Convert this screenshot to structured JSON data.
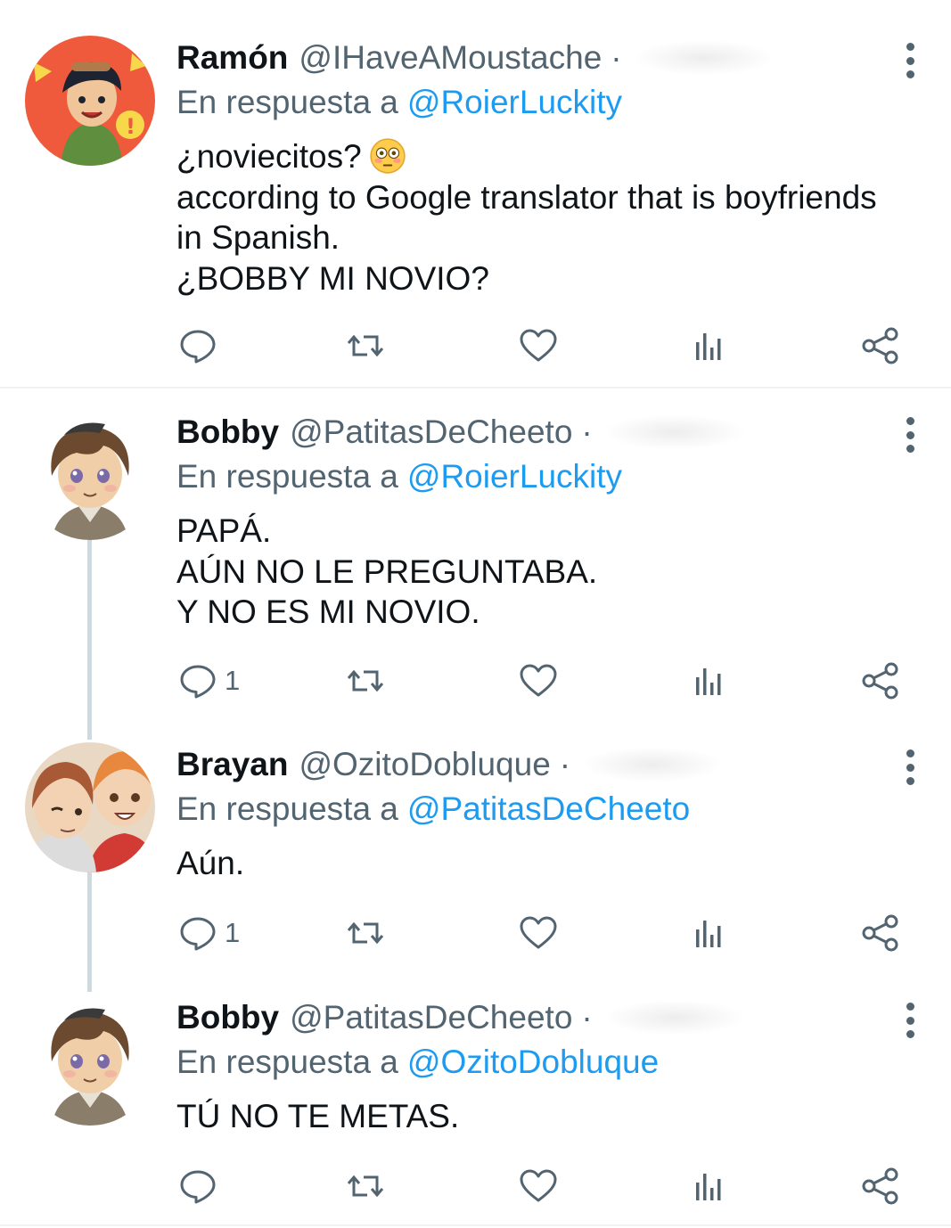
{
  "tweets": [
    {
      "name": "Ramón",
      "handle": "@IHaveAMoustache",
      "separator": "·",
      "reply_prefix": "En respuesta a",
      "reply_to": "@RoierLuckity",
      "lines": [
        "¿noviecitos?",
        "according to Google translator that is boyfriends",
        "in Spanish.",
        "¿BOBBY MI NOVIO?"
      ],
      "emoji": "flushed-face-emoji",
      "reply_count": "",
      "avatar_colors": {
        "bg": "#ef5a3c",
        "skin": "#f1c59a",
        "hair": "#1d2330",
        "shirt": "#5f8f3e"
      }
    },
    {
      "name": "Bobby",
      "handle": "@PatitasDeCheeto",
      "separator": "·",
      "reply_prefix": "En respuesta a",
      "reply_to": "@RoierLuckity",
      "lines": [
        "PAPÁ.",
        "AÚN NO LE PREGUNTABA.",
        "Y NO ES MI NOVIO."
      ],
      "reply_count": "1",
      "avatar_colors": {
        "bg": "#ffffff",
        "skin": "#f0cfa8",
        "hair": "#6b4a2f",
        "shirt": "#8a7d6a"
      }
    },
    {
      "name": "Brayan",
      "handle": "@OzitoDobluque",
      "separator": "·",
      "reply_prefix": "En respuesta a",
      "reply_to": "@PatitasDeCheeto",
      "lines": [
        "Aún."
      ],
      "reply_count": "1",
      "avatar_colors": {
        "bg": "#e9d8c4",
        "skin": "#f3d2b3",
        "hair": "#a85a36",
        "shirt": "#d23a34"
      }
    },
    {
      "name": "Bobby",
      "handle": "@PatitasDeCheeto",
      "separator": "·",
      "reply_prefix": "En respuesta a",
      "reply_to": "@OzitoDobluque",
      "lines": [
        "TÚ NO TE METAS."
      ],
      "reply_count": "",
      "avatar_colors": {
        "bg": "#ffffff",
        "skin": "#f0cfa8",
        "hair": "#6b4a2f",
        "shirt": "#8a7d6a"
      }
    }
  ],
  "icons": [
    "reply-icon",
    "retweet-icon",
    "like-icon",
    "analytics-icon",
    "share-icon",
    "more-options-icon"
  ],
  "colors": {
    "link": "#1d9bf0",
    "secondary": "#536471",
    "text": "#0f1419",
    "thread_line": "#cfd9de",
    "separator": "#eff3f4"
  }
}
